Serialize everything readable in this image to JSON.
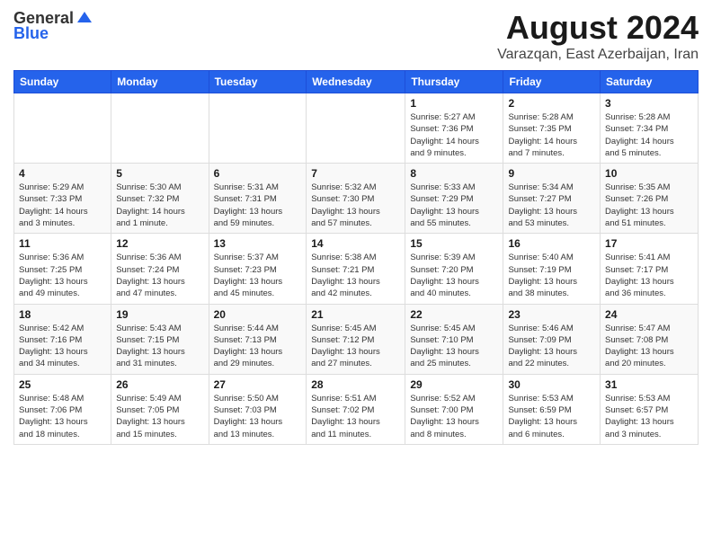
{
  "header": {
    "logo_line1": "General",
    "logo_line2": "Blue",
    "month_title": "August 2024",
    "location": "Varazqan, East Azerbaijan, Iran"
  },
  "weekdays": [
    "Sunday",
    "Monday",
    "Tuesday",
    "Wednesday",
    "Thursday",
    "Friday",
    "Saturday"
  ],
  "weeks": [
    [
      {
        "day": "",
        "info": ""
      },
      {
        "day": "",
        "info": ""
      },
      {
        "day": "",
        "info": ""
      },
      {
        "day": "",
        "info": ""
      },
      {
        "day": "1",
        "info": "Sunrise: 5:27 AM\nSunset: 7:36 PM\nDaylight: 14 hours\nand 9 minutes."
      },
      {
        "day": "2",
        "info": "Sunrise: 5:28 AM\nSunset: 7:35 PM\nDaylight: 14 hours\nand 7 minutes."
      },
      {
        "day": "3",
        "info": "Sunrise: 5:28 AM\nSunset: 7:34 PM\nDaylight: 14 hours\nand 5 minutes."
      }
    ],
    [
      {
        "day": "4",
        "info": "Sunrise: 5:29 AM\nSunset: 7:33 PM\nDaylight: 14 hours\nand 3 minutes."
      },
      {
        "day": "5",
        "info": "Sunrise: 5:30 AM\nSunset: 7:32 PM\nDaylight: 14 hours\nand 1 minute."
      },
      {
        "day": "6",
        "info": "Sunrise: 5:31 AM\nSunset: 7:31 PM\nDaylight: 13 hours\nand 59 minutes."
      },
      {
        "day": "7",
        "info": "Sunrise: 5:32 AM\nSunset: 7:30 PM\nDaylight: 13 hours\nand 57 minutes."
      },
      {
        "day": "8",
        "info": "Sunrise: 5:33 AM\nSunset: 7:29 PM\nDaylight: 13 hours\nand 55 minutes."
      },
      {
        "day": "9",
        "info": "Sunrise: 5:34 AM\nSunset: 7:27 PM\nDaylight: 13 hours\nand 53 minutes."
      },
      {
        "day": "10",
        "info": "Sunrise: 5:35 AM\nSunset: 7:26 PM\nDaylight: 13 hours\nand 51 minutes."
      }
    ],
    [
      {
        "day": "11",
        "info": "Sunrise: 5:36 AM\nSunset: 7:25 PM\nDaylight: 13 hours\nand 49 minutes."
      },
      {
        "day": "12",
        "info": "Sunrise: 5:36 AM\nSunset: 7:24 PM\nDaylight: 13 hours\nand 47 minutes."
      },
      {
        "day": "13",
        "info": "Sunrise: 5:37 AM\nSunset: 7:23 PM\nDaylight: 13 hours\nand 45 minutes."
      },
      {
        "day": "14",
        "info": "Sunrise: 5:38 AM\nSunset: 7:21 PM\nDaylight: 13 hours\nand 42 minutes."
      },
      {
        "day": "15",
        "info": "Sunrise: 5:39 AM\nSunset: 7:20 PM\nDaylight: 13 hours\nand 40 minutes."
      },
      {
        "day": "16",
        "info": "Sunrise: 5:40 AM\nSunset: 7:19 PM\nDaylight: 13 hours\nand 38 minutes."
      },
      {
        "day": "17",
        "info": "Sunrise: 5:41 AM\nSunset: 7:17 PM\nDaylight: 13 hours\nand 36 minutes."
      }
    ],
    [
      {
        "day": "18",
        "info": "Sunrise: 5:42 AM\nSunset: 7:16 PM\nDaylight: 13 hours\nand 34 minutes."
      },
      {
        "day": "19",
        "info": "Sunrise: 5:43 AM\nSunset: 7:15 PM\nDaylight: 13 hours\nand 31 minutes."
      },
      {
        "day": "20",
        "info": "Sunrise: 5:44 AM\nSunset: 7:13 PM\nDaylight: 13 hours\nand 29 minutes."
      },
      {
        "day": "21",
        "info": "Sunrise: 5:45 AM\nSunset: 7:12 PM\nDaylight: 13 hours\nand 27 minutes."
      },
      {
        "day": "22",
        "info": "Sunrise: 5:45 AM\nSunset: 7:10 PM\nDaylight: 13 hours\nand 25 minutes."
      },
      {
        "day": "23",
        "info": "Sunrise: 5:46 AM\nSunset: 7:09 PM\nDaylight: 13 hours\nand 22 minutes."
      },
      {
        "day": "24",
        "info": "Sunrise: 5:47 AM\nSunset: 7:08 PM\nDaylight: 13 hours\nand 20 minutes."
      }
    ],
    [
      {
        "day": "25",
        "info": "Sunrise: 5:48 AM\nSunset: 7:06 PM\nDaylight: 13 hours\nand 18 minutes."
      },
      {
        "day": "26",
        "info": "Sunrise: 5:49 AM\nSunset: 7:05 PM\nDaylight: 13 hours\nand 15 minutes."
      },
      {
        "day": "27",
        "info": "Sunrise: 5:50 AM\nSunset: 7:03 PM\nDaylight: 13 hours\nand 13 minutes."
      },
      {
        "day": "28",
        "info": "Sunrise: 5:51 AM\nSunset: 7:02 PM\nDaylight: 13 hours\nand 11 minutes."
      },
      {
        "day": "29",
        "info": "Sunrise: 5:52 AM\nSunset: 7:00 PM\nDaylight: 13 hours\nand 8 minutes."
      },
      {
        "day": "30",
        "info": "Sunrise: 5:53 AM\nSunset: 6:59 PM\nDaylight: 13 hours\nand 6 minutes."
      },
      {
        "day": "31",
        "info": "Sunrise: 5:53 AM\nSunset: 6:57 PM\nDaylight: 13 hours\nand 3 minutes."
      }
    ]
  ]
}
